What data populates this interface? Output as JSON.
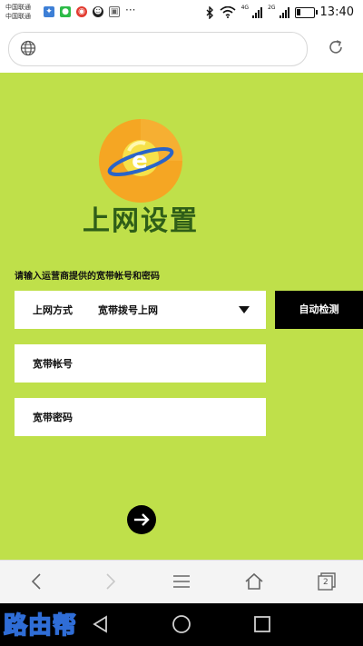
{
  "status_bar": {
    "carrier_line1": "中国联通",
    "carrier_line2": "中国联通",
    "more": "···",
    "signal1_label": "4G",
    "signal2_label": "2G",
    "time": "13:40",
    "icons": [
      "weibo-notif-icon",
      "wechat-notif-icon",
      "weibo-red-icon",
      "qq-icon",
      "image-icon",
      "bluetooth-icon",
      "wifi-icon",
      "signal-icon",
      "battery-icon"
    ]
  },
  "browser": {
    "url_value": "",
    "icons": [
      "globe-icon",
      "reload-icon"
    ]
  },
  "page": {
    "title": "上网设置",
    "hint": "请输入运营商提供的宽带帐号和密码",
    "connection": {
      "label": "上网方式",
      "value": "宽带拨号上网"
    },
    "auto_detect_label": "自动检测",
    "account_placeholder": "宽带帐号",
    "password_placeholder": "宽带密码",
    "colors": {
      "background": "#bfe04a",
      "title": "#2f5e18",
      "button": "#000000"
    }
  },
  "browser_toolbar": {
    "tab_count": "2",
    "icons": [
      "back-icon",
      "forward-icon",
      "menu-icon",
      "home-icon",
      "tabs-icon"
    ]
  },
  "watermark": {
    "brand": "路由帮"
  },
  "nav_bar": {
    "icons": [
      "nav-back-icon",
      "nav-home-icon",
      "nav-recents-icon"
    ]
  }
}
